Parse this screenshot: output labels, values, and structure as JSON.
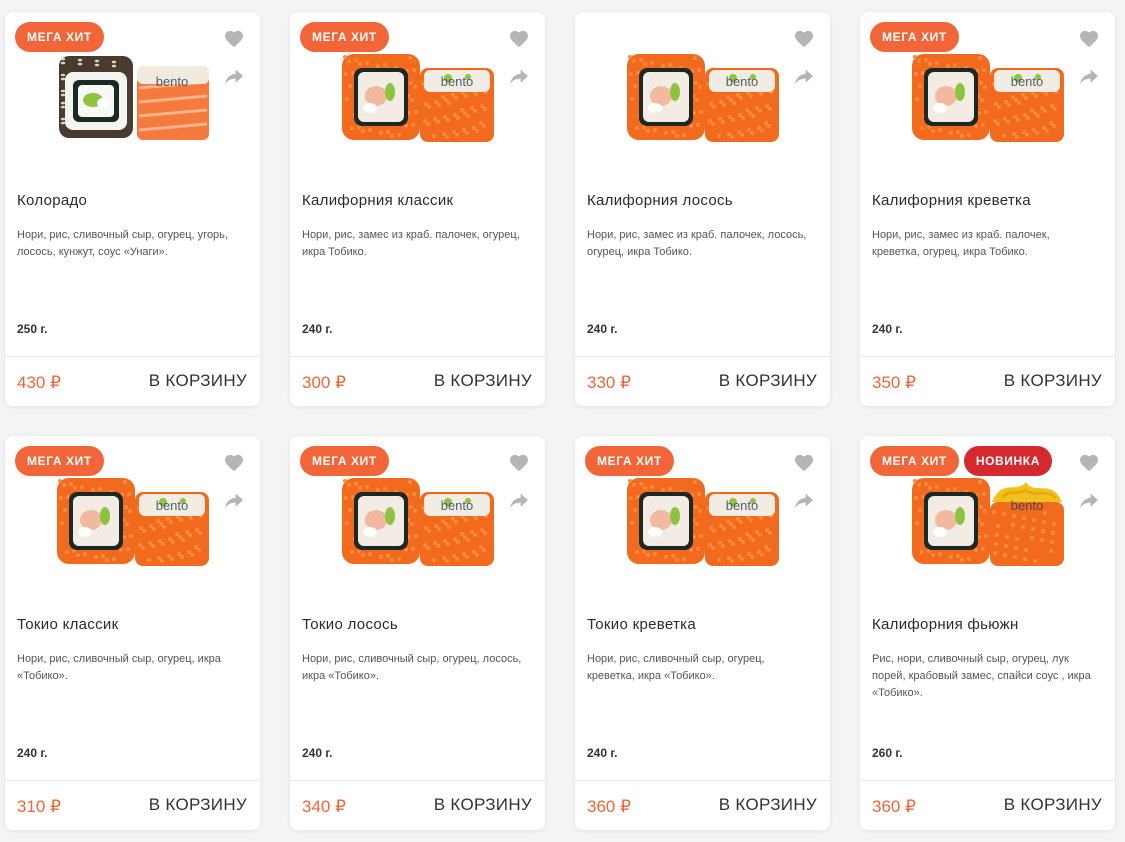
{
  "products": [
    {
      "badges": [
        "МЕГА ХИТ"
      ],
      "title": "Колорадо",
      "desc": "Нори, рис, сливочный сыр, огурец, угорь, лосось, кунжут, соус «Унаги».",
      "weight": "250 г.",
      "price": "430 ₽",
      "cart": "В КОРЗИНУ",
      "roll": "sesame",
      "side": "salmon"
    },
    {
      "badges": [
        "МЕГА ХИТ"
      ],
      "title": "Калифорния классик",
      "desc": "Нори, рис, замес из краб. палочек, огурец, икра Тобико.",
      "weight": "240 г.",
      "price": "300 ₽",
      "cart": "В КОРЗИНУ",
      "roll": "tobiko",
      "side": "tobiko"
    },
    {
      "badges": [],
      "title": "Калифорния лосось",
      "desc": "Нори, рис, замес из краб. палочек, лосось, огурец, икра Тобико.",
      "weight": "240 г.",
      "price": "330 ₽",
      "cart": "В КОРЗИНУ",
      "roll": "tobiko",
      "side": "tobiko"
    },
    {
      "badges": [
        "МЕГА ХИТ"
      ],
      "title": "Калифорния креветка",
      "desc": "Нори, рис, замес из краб. палочек, креветка, огурец, икра Тобико.",
      "weight": "240 г.",
      "price": "350 ₽",
      "cart": "В КОРЗИНУ",
      "roll": "tobiko",
      "side": "tobiko"
    },
    {
      "badges": [
        "МЕГА ХИТ"
      ],
      "title": "Токио классик",
      "desc": "Нори, рис, сливочный сыр, огурец, икра «Тобико».",
      "weight": "240 г.",
      "price": "310 ₽",
      "cart": "В КОРЗИНУ",
      "roll": "tobiko",
      "side": "tobiko"
    },
    {
      "badges": [
        "МЕГА ХИТ"
      ],
      "title": "Токио лосось",
      "desc": "Нори, рис, сливочный сыр, огурец, лосось, икра «Тобико».",
      "weight": "240 г.",
      "price": "340 ₽",
      "cart": "В КОРЗИНУ",
      "roll": "tobiko",
      "side": "tobiko"
    },
    {
      "badges": [
        "МЕГА ХИТ"
      ],
      "title": "Токио креветка",
      "desc": "Нори, рис, сливочный сыр, огурец, креветка, икра «Тобико».",
      "weight": "240 г.",
      "price": "360 ₽",
      "cart": "В КОРЗИНУ",
      "roll": "tobiko",
      "side": "tobiko"
    },
    {
      "badges": [
        "МЕГА ХИТ",
        "НОВИНКА"
      ],
      "title": "Калифорния фьюжн",
      "desc": "Рис, нори, сливочный сыр, огурец, лук порей, крабовый замес, спайси соус , икра «Тобико».",
      "weight": "260 г.",
      "price": "360 ₽",
      "cart": "В КОРЗИНУ",
      "roll": "tobiko",
      "side": "spicy"
    }
  ],
  "logo_text": "bento",
  "icons": {
    "favorite": "heart-icon",
    "share": "share-icon"
  },
  "colors": {
    "accent": "#f26538",
    "new_badge": "#d42a2f",
    "icon": "#b5b5b5",
    "background": "#f4f4f4"
  }
}
